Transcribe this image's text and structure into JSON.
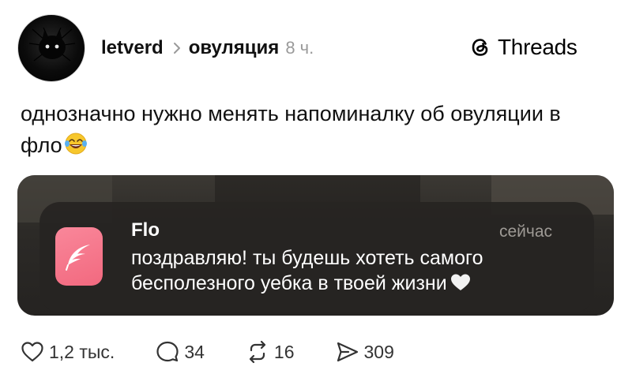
{
  "post": {
    "username": "letverd",
    "topic": "овуляция",
    "time": "8 ч.",
    "brand": "Threads",
    "text": "однозначно нужно менять напоминалку об овуляции в фло",
    "emoji": "face-with-tears-of-joy"
  },
  "notification": {
    "app": "Flo",
    "time": "сейчас",
    "message": "поздравляю! ты будешь хотеть самого бесполезного уебка в твоей жизни",
    "icon": "flo-app-icon",
    "accent": "#f2697f"
  },
  "actions": {
    "likes": "1,2 тыс.",
    "comments": "34",
    "reposts": "16",
    "shares": "309"
  },
  "colors": {
    "text": "#111111",
    "muted": "#9a9a9a",
    "card_bg": "#262422"
  }
}
